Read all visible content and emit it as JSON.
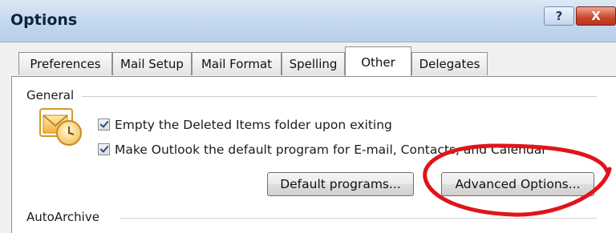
{
  "window": {
    "title": "Options",
    "help_label": "?",
    "close_label": "X"
  },
  "tabs": [
    {
      "label": "Preferences"
    },
    {
      "label": "Mail Setup"
    },
    {
      "label": "Mail Format"
    },
    {
      "label": "Spelling"
    },
    {
      "label": "Other"
    },
    {
      "label": "Delegates"
    }
  ],
  "general": {
    "label": "General",
    "checkboxes": [
      {
        "label": "Empty the Deleted Items folder upon exiting",
        "checked": true
      },
      {
        "label": "Make Outlook the default program for E-mail, Contacts, and Calendar",
        "checked": true
      }
    ],
    "default_programs_button": "Default programs...",
    "advanced_options_button": "Advanced Options..."
  },
  "autoarchive": {
    "label": "AutoArchive"
  },
  "colors": {
    "highlight_ellipse": "#e0141c"
  }
}
